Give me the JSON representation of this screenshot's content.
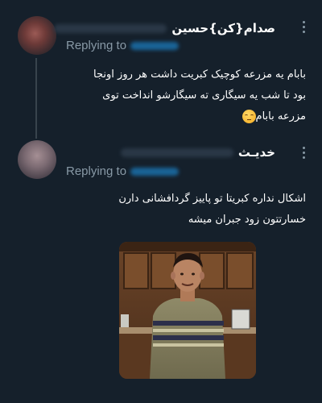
{
  "theme": {
    "background": "#15202b",
    "text_primary": "#ffffff",
    "text_secondary": "#8899a6",
    "accent": "#1d9bf0",
    "thread_line": "#38444d"
  },
  "thread": {
    "tweets": [
      {
        "display_name": "صدام{کن}حسین",
        "handle_blurred": true,
        "replying_label": "Replying to",
        "mention_blurred": true,
        "more_icon": "more-vertical-icon",
        "body_lines": [
          "بابام یه مزرعه کوچیک کبریت داشت هر روز اونجا",
          "بود تا شب یه سیگاری ته سیگارشو انداخت توی",
          "مزرعه بابام"
        ],
        "emoji": "pensive-face-emoji"
      },
      {
        "display_name": "خدیـث",
        "handle_blurred": true,
        "replying_label": "Replying to",
        "mention_blurred": true,
        "more_icon": "more-vertical-icon",
        "body_lines": [
          "اشکال نداره کبریتا تو پاییز گردافشانی دارن",
          "خسارتتون زود جبران میشه"
        ],
        "media": "attached-photo"
      }
    ]
  }
}
